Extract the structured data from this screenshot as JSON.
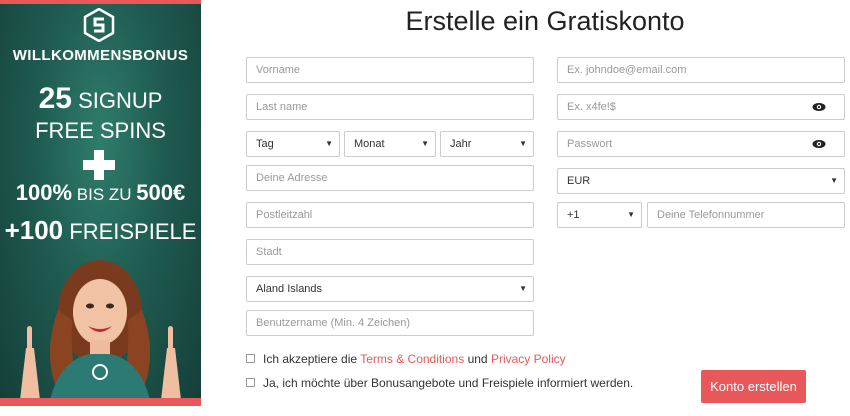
{
  "promo": {
    "heading": "WILLKOMMENSBONUS",
    "signup_number": "25",
    "signup_word": "SIGNUP",
    "free_spins": "FREE SPINS",
    "bonus_percent": "100%",
    "bonus_mid": "BIS ZU",
    "bonus_amount": "500€",
    "extra_spins_number": "+100",
    "extra_spins_word": "FREISPIELE"
  },
  "form": {
    "title": "Erstelle ein Gratiskonto",
    "firstname_placeholder": "Vorname",
    "lastname_placeholder": "Last name",
    "day_label": "Tag",
    "month_label": "Monat",
    "year_label": "Jahr",
    "address_placeholder": "Deine Adresse",
    "zip_placeholder": "Postleitzahl",
    "city_placeholder": "Stadt",
    "country_value": "Aland Islands",
    "username_placeholder": "Benutzername (Min. 4 Zeichen)",
    "email_placeholder": "Ex. johndoe@email.com",
    "password_placeholder": "Ex. x4fe!$",
    "password_confirm_placeholder": "Passwort",
    "currency_value": "EUR",
    "phone_code_value": "+1",
    "phone_placeholder": "Deine Telefonnummer",
    "terms_prefix": "Ich akzeptiere die",
    "terms_link": "Terms & Conditions",
    "terms_and": "und",
    "privacy_link": "Privacy Policy",
    "newsletter_label": "Ja, ich möchte über Bonusangebote und Freispiele informiert werden.",
    "submit_label": "Konto erstellen"
  },
  "colors": {
    "accent": "#e8585a",
    "promo_bg": "#1f5b50"
  }
}
